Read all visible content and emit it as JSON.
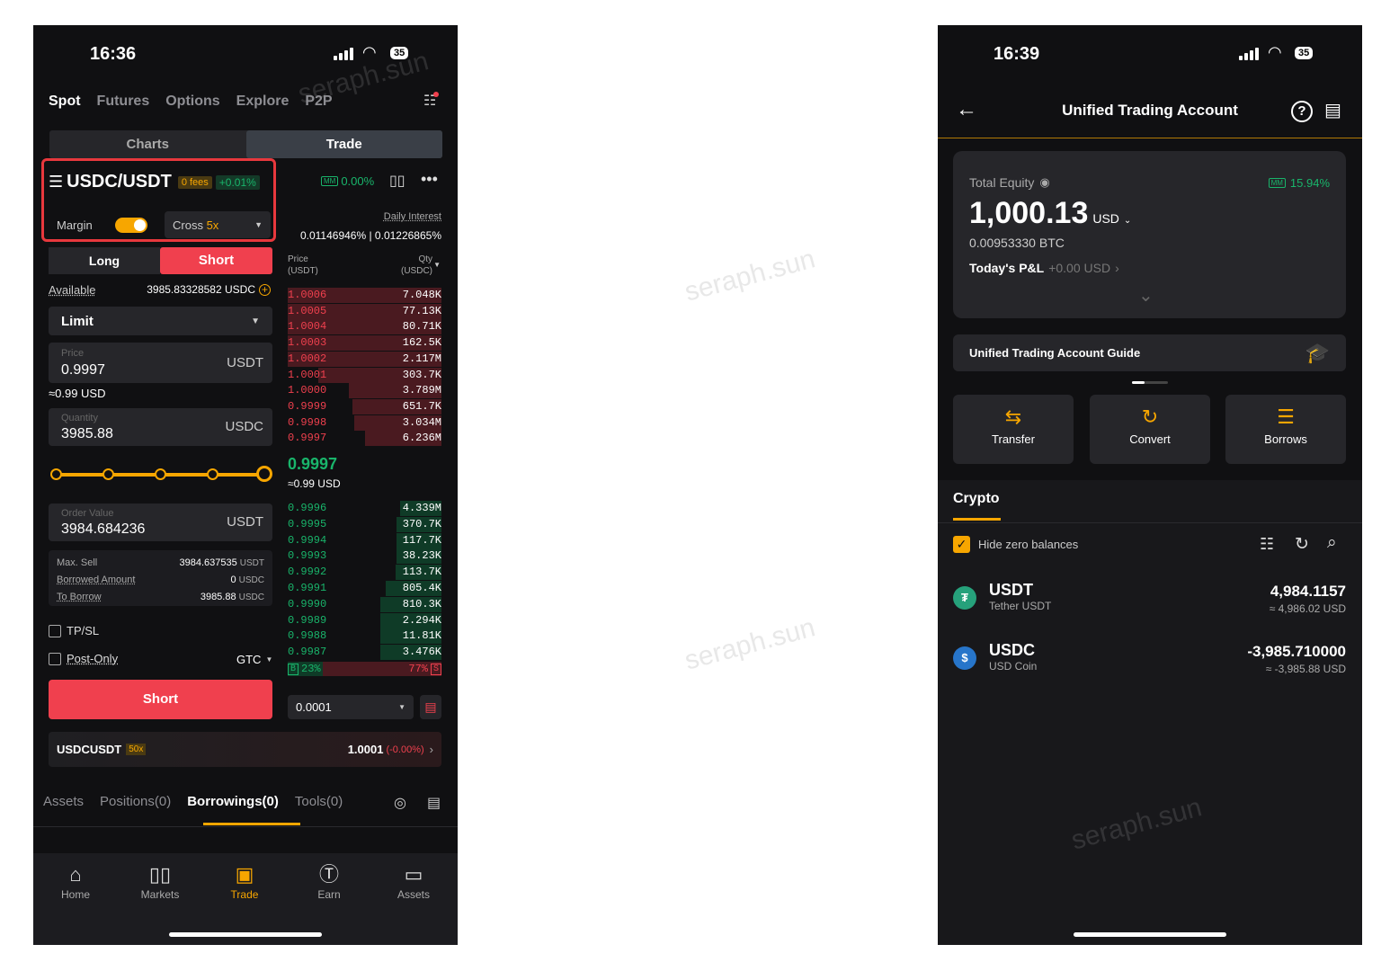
{
  "left": {
    "status_time": "16:36",
    "battery": "35",
    "nav_tabs": [
      "Spot",
      "Futures",
      "Options",
      "Explore",
      "P2P"
    ],
    "chart_tab": "Charts",
    "trade_tab": "Trade",
    "pair": "USDC/USDT",
    "fees_badge": "0 fees",
    "change_badge": "+0.01%",
    "mm_label": "MM",
    "mm_value": "0.00%",
    "daily_interest_label": "Daily Interest",
    "daily_interest_value": "0.01146946% | 0.01226865%",
    "margin_label": "Margin",
    "cross_label": "Cross",
    "cross_lev": "5x",
    "long_tab": "Long",
    "short_tab": "Short",
    "available_label": "Available",
    "available_value": "3985.83328582 USDC",
    "order_type": "Limit",
    "price_label": "Price",
    "price_value": "0.9997",
    "price_unit": "USDT",
    "price_usd": "≈0.99 USD",
    "qty_label": "Quantity",
    "qty_value": "3985.88",
    "qty_unit": "USDC",
    "order_value_label": "Order Value",
    "order_value": "3984.684236",
    "order_value_unit": "USDT",
    "max_sell_label": "Max. Sell",
    "max_sell_value": "3984.637535",
    "max_sell_unit": "USDT",
    "borrowed_label": "Borrowed Amount",
    "borrowed_value": "0",
    "borrowed_unit": "USDC",
    "to_borrow_label": "To Borrow",
    "to_borrow_value": "3985.88",
    "to_borrow_unit": "USDC",
    "tpsl_label": "TP/SL",
    "post_only_label": "Post-Only",
    "gtc_label": "GTC",
    "short_button": "Short",
    "ob_price_head": "Price",
    "ob_price_head_unit": "(USDT)",
    "ob_qty_head": "Qty",
    "ob_qty_head_unit": "(USDC)",
    "asks": [
      {
        "p": "1.0006",
        "q": "7.048K",
        "d": 1.0
      },
      {
        "p": "1.0005",
        "q": "77.13K",
        "d": 1.0
      },
      {
        "p": "1.0004",
        "q": "80.71K",
        "d": 1.0
      },
      {
        "p": "1.0003",
        "q": "162.5K",
        "d": 1.0
      },
      {
        "p": "1.0002",
        "q": "2.117M",
        "d": 1.0
      },
      {
        "p": "1.0001",
        "q": "303.7K",
        "d": 0.8
      },
      {
        "p": "1.0000",
        "q": "3.789M",
        "d": 0.6
      },
      {
        "p": "0.9999",
        "q": "651.7K",
        "d": 0.58
      },
      {
        "p": "0.9998",
        "q": "3.034M",
        "d": 0.57
      },
      {
        "p": "0.9997",
        "q": "6.236M",
        "d": 0.5
      }
    ],
    "last_price": "0.9997",
    "last_price_usd": "≈0.99 USD",
    "bids": [
      {
        "p": "0.9996",
        "q": "4.339M",
        "d": 0.27
      },
      {
        "p": "0.9995",
        "q": "370.7K",
        "d": 0.29
      },
      {
        "p": "0.9994",
        "q": "117.7K",
        "d": 0.29
      },
      {
        "p": "0.9993",
        "q": "38.23K",
        "d": 0.29
      },
      {
        "p": "0.9992",
        "q": "113.7K",
        "d": 0.3
      },
      {
        "p": "0.9991",
        "q": "805.4K",
        "d": 0.36
      },
      {
        "p": "0.9990",
        "q": "810.3K",
        "d": 0.4
      },
      {
        "p": "0.9989",
        "q": "2.294K",
        "d": 0.4
      },
      {
        "p": "0.9988",
        "q": "11.81K",
        "d": 0.4
      },
      {
        "p": "0.9987",
        "q": "3.476K",
        "d": 0.4
      }
    ],
    "b_label": "B",
    "b_pct": "23%",
    "s_label": "S",
    "s_pct": "77%",
    "precision": "0.0001",
    "ticker_symbol": "USDCUSDT",
    "ticker_lev": "50x",
    "ticker_price": "1.0001",
    "ticker_change": "(-0.00%)",
    "bottom_tabs": [
      "Assets",
      "Positions(0)",
      "Borrowings(0)",
      "Tools(0)"
    ],
    "nav_items": [
      "Home",
      "Markets",
      "Trade",
      "Earn",
      "Assets"
    ]
  },
  "right": {
    "status_time": "16:39",
    "battery": "35",
    "title": "Unified Trading Account",
    "total_equity_label": "Total Equity",
    "mm_label": "MM",
    "mm_value": "15.94%",
    "equity_value": "1,000.13",
    "equity_unit": "USD",
    "btc_value": "0.00953330 BTC",
    "pnl_label": "Today's P&L",
    "pnl_value": "+0.00 USD",
    "guide": "Unified Trading Account Guide",
    "actions": [
      "Transfer",
      "Convert",
      "Borrows"
    ],
    "crypto_tab": "Crypto",
    "hide_zero": "Hide zero balances",
    "assets": [
      {
        "symbol": "USDT",
        "name": "Tether USDT",
        "amount": "4,984.1157",
        "usd": "≈ 4,986.02 USD",
        "color": "#26a17b"
      },
      {
        "symbol": "USDC",
        "name": "USD Coin",
        "amount": "-3,985.710000",
        "usd": "≈ -3,985.88 USD",
        "color": "#2775ca"
      }
    ]
  },
  "watermark": "seraph.sun",
  "colors": {
    "accent": "#f7a600",
    "red": "#f0404e",
    "green": "#19b56b",
    "highlight": "#e8383d"
  }
}
